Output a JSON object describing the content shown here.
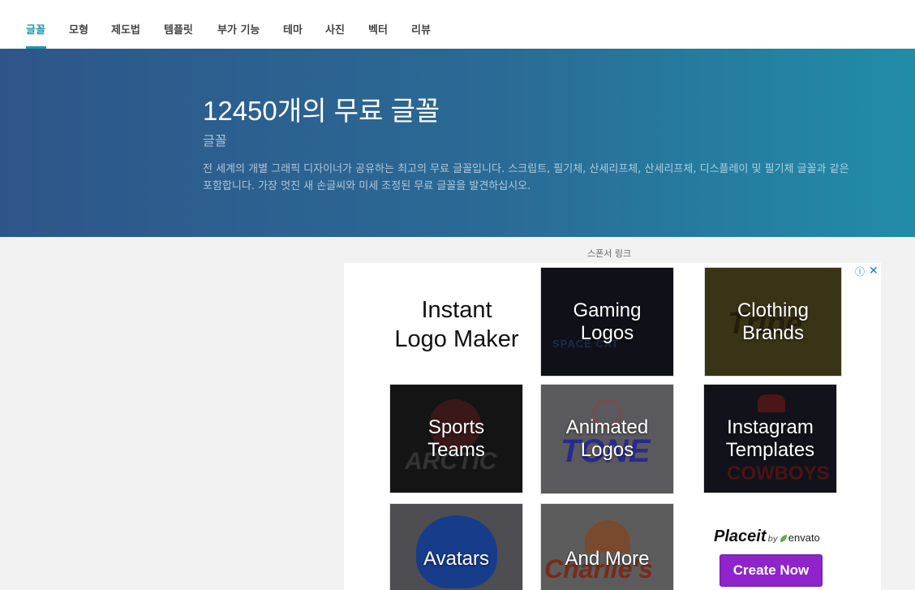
{
  "nav": {
    "tabs": [
      {
        "label": "글꼴",
        "active": true
      },
      {
        "label": "모형"
      },
      {
        "label": "제도법"
      },
      {
        "label": "템플릿"
      },
      {
        "label": "부가 기능"
      },
      {
        "label": "테마"
      },
      {
        "label": "사진"
      },
      {
        "label": "벡터"
      },
      {
        "label": "리뷰"
      }
    ]
  },
  "hero": {
    "title": "12450개의 무료 글꼴",
    "subtitle": "글꼴",
    "description_line1": "전 세계의 개별 그래픽 디자이너가 공유하는 최고의 무료 글꼴입니다. 스크립트, 필기체, 산세리프체, 산세리프체, 디스플레이 및 필기체 글꼴과 같은",
    "description_line2": "포함합니다. 가장 멋진 새 손글씨와 미세 조정된 무료 글꼴을 발견하십시오."
  },
  "sponsor_label": "스폰서 링크",
  "ad": {
    "info_icon": "info-icon",
    "close_icon": "close-icon",
    "logo_maker_line1": "Instant",
    "logo_maker_line2": "Logo Maker",
    "tiles": [
      {
        "line1": "Gaming",
        "line2": "Logos"
      },
      {
        "line1": "Clothing",
        "line2": "Brands"
      },
      {
        "line1": "Sports",
        "line2": "Teams"
      },
      {
        "line1": "Animated",
        "line2": "Logos"
      },
      {
        "line1": "Instagram",
        "line2": "Templates"
      },
      {
        "line1": "Avatars",
        "line2": ""
      },
      {
        "line1": "And More",
        "line2": ""
      }
    ],
    "brand": {
      "name": "Placeit",
      "by": "by",
      "partner": "envato"
    },
    "cta": "Create Now"
  },
  "colors": {
    "accent": "#1f97a6",
    "hero_start": "#2e5589",
    "hero_end": "#218ca8",
    "cta": "#8e24c9"
  }
}
